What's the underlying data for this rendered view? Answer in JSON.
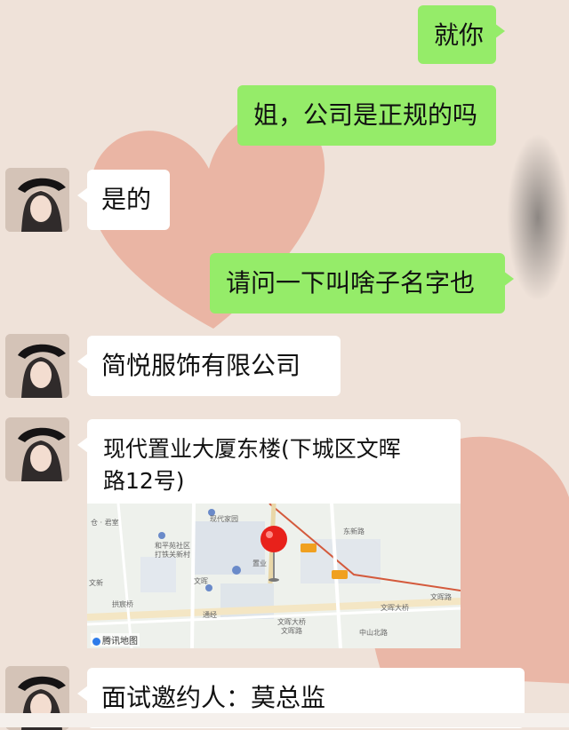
{
  "messages": [
    {
      "side": "out",
      "text": "就你"
    },
    {
      "side": "out",
      "text": "姐，公司是正规的吗"
    },
    {
      "side": "in",
      "text": "是的"
    },
    {
      "side": "out",
      "text": "请问一下叫啥子名字也"
    },
    {
      "side": "in",
      "text": "简悦服饰有限公司"
    },
    {
      "side": "in",
      "type": "location",
      "title": "现代置业大厦东楼(下城区文晖路12号)"
    },
    {
      "side": "in",
      "text": "面试邀约人：莫总监"
    }
  ],
  "location": {
    "title_line1": "现代置业大厦东楼(下城区文晖",
    "title_line2": "路12号)",
    "map_brand": "腾讯地图",
    "map_labels": {
      "top_left": "仓 · 君室",
      "xiandai": "现代家园",
      "heping": "和平苑社区",
      "heping2": "打铁关新村",
      "zhiye": "置业",
      "wenhui": "文晖",
      "wenxin": "文新",
      "gongchen": "拱宸桥",
      "tongjiao": "通经",
      "wenhuidaqiao": "文晖大桥",
      "wenhuidaqiao2": "文晖大桥",
      "wenhui_stop": "文晖路",
      "zhongshan": "中山北路",
      "dongxin": "东新路",
      "wenhuijie": "文晖路"
    }
  },
  "colors": {
    "outgoing": "#95ec69",
    "incoming": "#ffffff",
    "background": "#efe2d9",
    "heart": "#e8a592"
  }
}
